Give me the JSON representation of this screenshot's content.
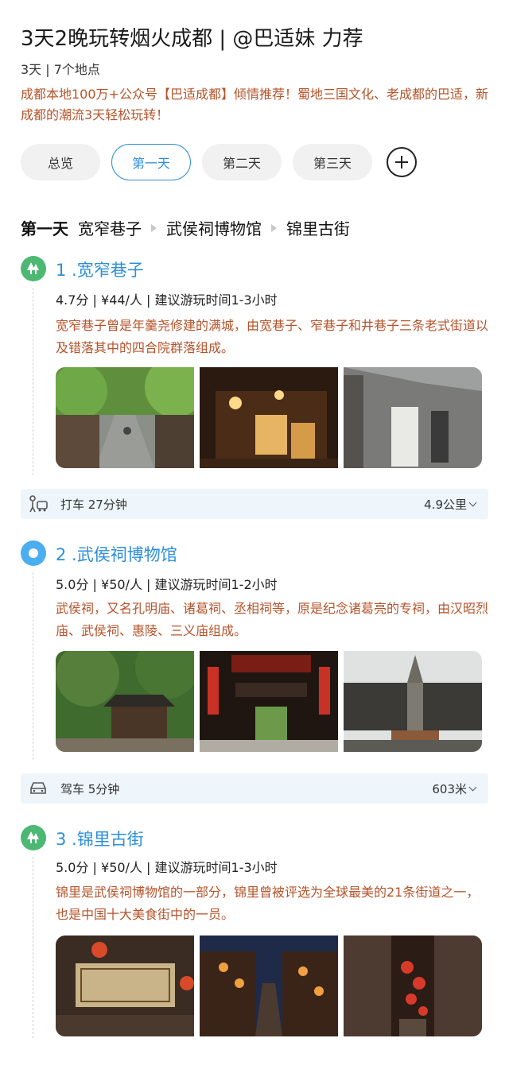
{
  "header": {
    "title": "3天2晚玩转烟火成都 | @巴适妹 力荐",
    "meta": "3天 | 7个地点",
    "description": "成都本地100万+公众号【巴适成都】倾情推荐！蜀地三国文化、老成都的巴适，新成都的潮流3天轻松玩转！"
  },
  "tabs": [
    {
      "label": "总览",
      "active": false
    },
    {
      "label": "第一天",
      "active": true
    },
    {
      "label": "第二天",
      "active": false
    },
    {
      "label": "第三天",
      "active": false
    }
  ],
  "add_icon": "plus-circle-icon",
  "route": {
    "day": "第一天",
    "stops": [
      "宽窄巷子",
      "武侯祠博物馆",
      "锦里古街"
    ]
  },
  "stops": [
    {
      "name": "1 .宽窄巷子",
      "icon": "tree-icon",
      "icon_color": "#4cb873",
      "stats": "4.7分 | ¥44/人 | 建议游玩时间1-3小时",
      "description": "宽窄巷子曾是年羹尧修建的满城，由宽巷子、窄巷子和井巷子三条老式街道以及错落其中的四合院群落组成。",
      "photos": [
        "tree-lined rainy alley",
        "lantern-lit wooden courtyard at night",
        "grey brick wall with posters"
      ]
    },
    {
      "name": "2 .武侯祠博物馆",
      "icon": "dot-icon",
      "icon_color": "#4aaef0",
      "stats": "5.0分 | ¥50/人 | 建议游玩时间1-2小时",
      "description": "武侯祠，又名孔明庙、诸葛祠、丞相祠等，原是纪念诸葛亮的专祠，由汉昭烈庙、武侯祠、惠陵、三义庙组成。",
      "photos": [
        "temple pavilion among trees",
        "red hall with lanterns and plaque",
        "stone pagoda before temple"
      ]
    },
    {
      "name": "3 .锦里古街",
      "icon": "tree-icon",
      "icon_color": "#4cb873",
      "stats": "5.0分 | ¥50/人 | 建议游玩时间1-3小时",
      "description": "锦里是武侯祠博物馆的一部分，锦里曾被评选为全球最美的21条街道之一，也是中国十大美食街中的一员。",
      "photos": [
        "wooden sign board",
        "night street with lanterns",
        "narrow alley with red lanterns"
      ]
    }
  ],
  "transits": [
    {
      "mode": "打车 27分钟",
      "distance": "4.9公里",
      "icon": "taxi-person-icon"
    },
    {
      "mode": "驾车 5分钟",
      "distance": "603米",
      "icon": "car-icon"
    }
  ],
  "colors": {
    "accent": "#2d8fd8",
    "description_text": "#b5532a",
    "transit_bg": "#eef6fc"
  }
}
